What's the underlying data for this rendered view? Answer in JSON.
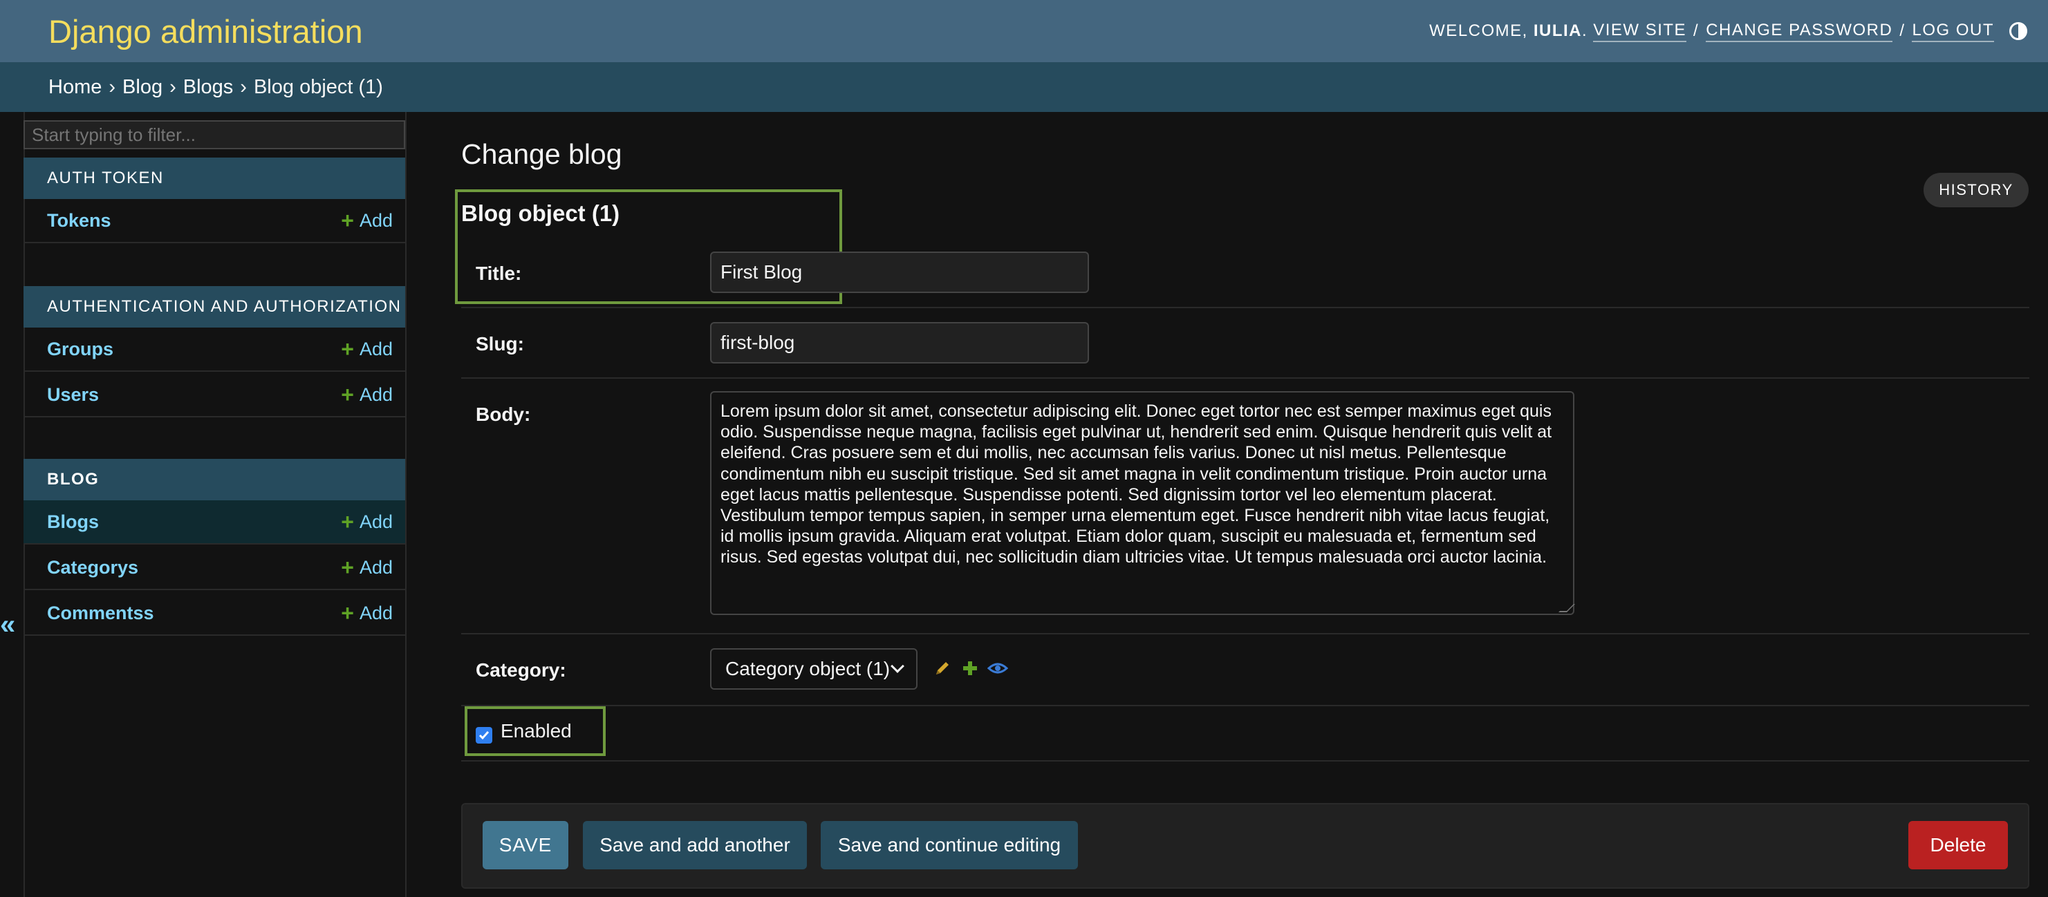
{
  "header": {
    "branding": "Django administration",
    "welcome": "Welcome,",
    "username": "Iulia",
    "period": ".",
    "view_site": "View site",
    "change_password": "Change password",
    "log_out": "Log out",
    "separator": "/"
  },
  "breadcrumbs": {
    "items": [
      "Home",
      "Blog",
      "Blogs"
    ],
    "current": "Blog object (1)",
    "arrow": "›"
  },
  "sidebar": {
    "filter_placeholder": "Start typing to filter...",
    "add_label": "Add",
    "modules": [
      {
        "caption": "Auth Token",
        "models": [
          "Tokens"
        ]
      },
      {
        "caption": "Authentication and Authorization",
        "models": [
          "Groups",
          "Users"
        ]
      },
      {
        "caption": "Blog",
        "models": [
          "Blogs",
          "Categorys",
          "Commentss"
        ]
      }
    ],
    "current_model": "Blogs",
    "toggle": "«"
  },
  "content": {
    "title": "Change blog",
    "history": "History",
    "object_title": "Blog object (1)",
    "fields": {
      "title_label": "Title:",
      "title_value": "First Blog",
      "slug_label": "Slug:",
      "slug_value": "first-blog",
      "body_label": "Body:",
      "body_value": "Lorem ipsum dolor sit amet, consectetur adipiscing elit. Donec eget tortor nec est semper maximus eget quis odio. Suspendisse neque magna, facilisis eget pulvinar ut, hendrerit sed enim. Quisque hendrerit quis velit at eleifend. Cras posuere sem et dui mollis, nec accumsan felis varius. Donec ut nisl metus. Pellentesque condimentum nibh eu suscipit tristique. Sed sit amet magna in velit condimentum tristique. Proin auctor urna eget lacus mattis pellentesque. Suspendisse potenti. Sed dignissim tortor vel leo elementum placerat. Vestibulum tempor tempus sapien, in semper urna elementum eget. Fusce hendrerit nibh vitae lacus feugiat, id mollis ipsum gravida. Aliquam erat volutpat. Etiam dolor quam, suscipit eu malesuada et, fermentum sed risus. Sed egestas volutpat dui, nec sollicitudin diam ultricies vitae. Ut tempus malesuada orci auctor lacinia.",
      "category_label": "Category:",
      "category_value": "Category object (1)",
      "enabled_label": "Enabled",
      "enabled_checked": true
    }
  },
  "submit": {
    "save": "Save",
    "save_add": "Save and add another",
    "save_continue": "Save and continue editing",
    "delete": "Delete"
  },
  "colors": {
    "header_bg": "#44667f",
    "branding": "#f5dd5d",
    "breadcrumb_bg": "#264b5d",
    "link": "#81d4fa",
    "add_plus": "#5fa225",
    "highlight": "#6f9a3e",
    "delete": "#ba2121"
  },
  "icons": {
    "theme": "theme-toggle-icon",
    "change_related": "pencil-icon",
    "add_related": "plus-icon",
    "view_related": "eye-icon"
  }
}
